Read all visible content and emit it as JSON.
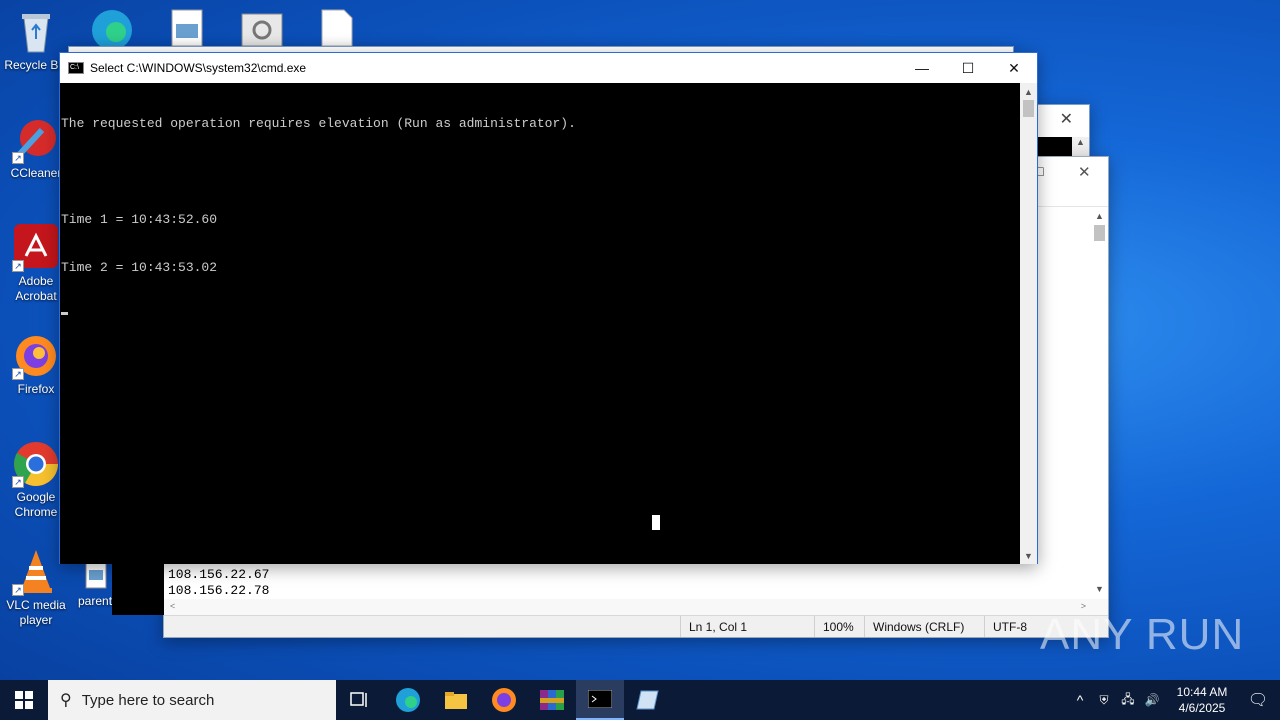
{
  "desktop": {
    "icons": [
      {
        "label": "Recycle Bin",
        "icon": "recycle-bin-icon"
      },
      {
        "label": "CCleaner",
        "icon": "ccleaner-icon"
      },
      {
        "label": "Adobe Acrobat",
        "icon": "adobe-acrobat-icon"
      },
      {
        "label": "Firefox",
        "icon": "firefox-icon"
      },
      {
        "label": "Google Chrome",
        "icon": "chrome-icon"
      },
      {
        "label": "VLC media player",
        "icon": "vlc-icon"
      },
      {
        "label": "parent",
        "icon": "file-icon"
      }
    ]
  },
  "cmd_window": {
    "title": "Select C:\\WINDOWS\\system32\\cmd.exe",
    "lines": [
      "The requested operation requires elevation (Run as administrator).",
      "",
      "Time 1 = 10:43:52.60",
      "Time 2 = 10:43:53.02"
    ]
  },
  "notepad_window": {
    "lines": [
      "108.156.22.67",
      "108.156.22.78"
    ],
    "status": {
      "position": "Ln 1, Col 1",
      "zoom": "100%",
      "line_ending": "Windows (CRLF)",
      "encoding": "UTF-8"
    }
  },
  "taskbar": {
    "search_placeholder": "Type here to search",
    "time": "10:44 AM",
    "date": "4/6/2025"
  },
  "watermark": "ANY RUN",
  "colors": {
    "desktop": "#1466d6",
    "taskbar": "#0b1a36",
    "console_bg": "#000000",
    "console_fg": "#cccccc"
  }
}
